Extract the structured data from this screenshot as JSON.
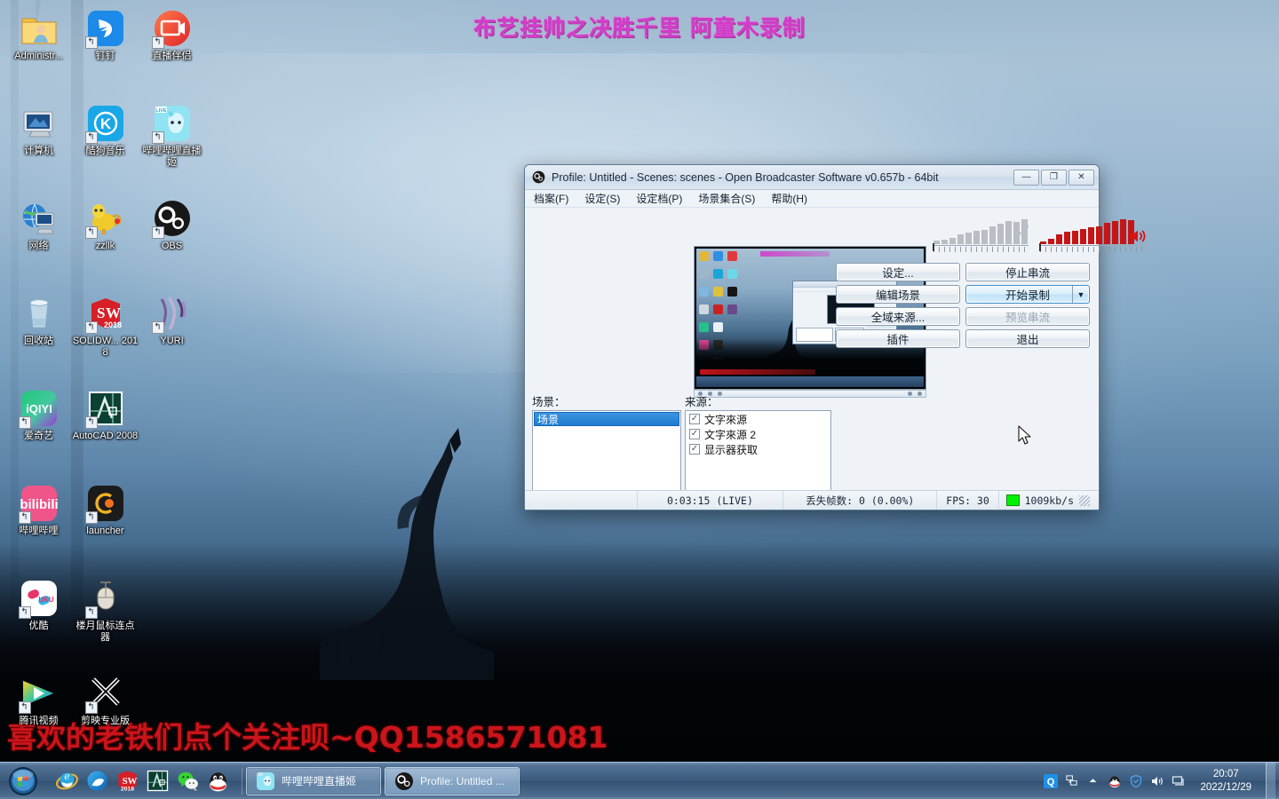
{
  "overlays": {
    "top_text": "布艺挂帅之决胜千里 阿童木录制",
    "bottom_text": "喜欢的老铁们点个关注呗~QQ1586571081"
  },
  "desktop": {
    "icons": [
      {
        "label": "Administr...",
        "name": "user-folder-icon",
        "shortcut": false
      },
      {
        "label": "钉钉",
        "name": "dingtalk-icon",
        "shortcut": true
      },
      {
        "label": "直播伴侣",
        "name": "live-companion-icon",
        "shortcut": true
      },
      {
        "label": "计算机",
        "name": "computer-icon",
        "shortcut": false
      },
      {
        "label": "酷狗音乐",
        "name": "kugou-music-icon",
        "shortcut": true
      },
      {
        "label": "哔哩哔哩直播姬",
        "name": "bilibili-live-icon",
        "shortcut": true
      },
      {
        "label": "网络",
        "name": "network-icon",
        "shortcut": false
      },
      {
        "label": "zzllk",
        "name": "zzllk-icon",
        "shortcut": true
      },
      {
        "label": "OBS",
        "name": "obs-icon",
        "shortcut": true
      },
      {
        "label": "回收站",
        "name": "recycle-bin-icon",
        "shortcut": false
      },
      {
        "label": "SOLIDW... 2018",
        "name": "solidworks-icon",
        "shortcut": true
      },
      {
        "label": "YURI",
        "name": "yuri-icon",
        "shortcut": true
      },
      {
        "label": "爱奇艺",
        "name": "iqiyi-icon",
        "shortcut": true
      },
      {
        "label": "AutoCAD 2008",
        "name": "autocad-icon",
        "shortcut": true
      },
      {
        "label": "",
        "name": "empty-slot",
        "shortcut": false
      },
      {
        "label": "哔哩哔哩",
        "name": "bilibili-icon",
        "shortcut": true
      },
      {
        "label": "launcher",
        "name": "launcher-icon",
        "shortcut": true
      },
      {
        "label": "",
        "name": "empty-slot",
        "shortcut": false
      },
      {
        "label": "优酷",
        "name": "youku-icon",
        "shortcut": true
      },
      {
        "label": "楼月鼠标连点器",
        "name": "auto-clicker-icon",
        "shortcut": true
      },
      {
        "label": "",
        "name": "empty-slot",
        "shortcut": false
      },
      {
        "label": "腾讯视频",
        "name": "tencent-video-icon",
        "shortcut": true
      },
      {
        "label": "剪映专业版",
        "name": "jianying-pro-icon",
        "shortcut": true
      },
      {
        "label": "",
        "name": "empty-slot",
        "shortcut": false
      }
    ]
  },
  "obs": {
    "title": "Profile: Untitled - Scenes: scenes - Open Broadcaster Software v0.657b - 64bit",
    "window_buttons": {
      "minimize": "—",
      "maximize": "❐",
      "close": "✕"
    },
    "menu": [
      {
        "label": "档案(F)",
        "name": "menu-file"
      },
      {
        "label": "设定(S)",
        "name": "menu-settings"
      },
      {
        "label": "设定档(P)",
        "name": "menu-profile"
      },
      {
        "label": "场景集合(S)",
        "name": "menu-scene-collection"
      },
      {
        "label": "帮助(H)",
        "name": "menu-help"
      }
    ],
    "scenes_label": "场景：",
    "sources_label": "来源：",
    "scenes": [
      {
        "name": "场景",
        "selected": true
      }
    ],
    "sources": [
      {
        "name": "文字來源",
        "checked": true
      },
      {
        "name": "文字來源 2",
        "checked": true
      },
      {
        "name": "显示器获取",
        "checked": true
      }
    ],
    "buttons": {
      "settings": "设定...",
      "edit_scene": "编辑场景",
      "global_sources": "全域来源...",
      "plugins": "插件",
      "stop_stream": "停止串流",
      "start_record": "开始录制",
      "preview_stream": "预览串流",
      "exit": "退出"
    },
    "status": {
      "time": "0:03:15  (LIVE)",
      "dropped_frames": "丢失帧数: 0  (0.00%)",
      "fps": "FPS: 30",
      "bitrate": "1009kb/s",
      "bitrate_chip_color": "#00f000"
    },
    "meters": {
      "mic_color": "#b9bec4",
      "desktop_color": "#c41616",
      "mic_levels": [
        4,
        5,
        7,
        11,
        13,
        15,
        16,
        20,
        23,
        26,
        25,
        28
      ],
      "desktop_levels": [
        3,
        6,
        11,
        14,
        15,
        17,
        19,
        20,
        24,
        26,
        28,
        27
      ]
    }
  },
  "taskbar": {
    "start_label": "Start",
    "quick_launch": [
      {
        "name": "internet-explorer-icon",
        "label": "Internet Explorer"
      },
      {
        "name": "qq-browser-icon",
        "label": "QQ浏览器"
      },
      {
        "name": "solidworks-taskbar-icon",
        "label": "SOLIDWORKS 2018"
      },
      {
        "name": "autocad-taskbar-icon",
        "label": "AutoCAD 2008"
      },
      {
        "name": "wechat-icon",
        "label": "微信"
      },
      {
        "name": "qq-icon",
        "label": "QQ"
      }
    ],
    "windows": [
      {
        "name": "taskbar-window-bilibili",
        "label": "哔哩哔哩直播姬",
        "active": false
      },
      {
        "name": "taskbar-window-obs",
        "label": "Profile: Untitled ...",
        "active": true
      }
    ],
    "tray": [
      {
        "name": "qq-tray-icon"
      },
      {
        "name": "network-tray-icon"
      },
      {
        "name": "show-hidden-icons-icon"
      },
      {
        "name": "qq-penguin-tray-icon"
      },
      {
        "name": "tencent-shield-tray-icon"
      },
      {
        "name": "volume-tray-icon"
      },
      {
        "name": "action-center-tray-icon"
      }
    ],
    "clock": {
      "time": "20:07",
      "date": "2022/12/29"
    }
  }
}
